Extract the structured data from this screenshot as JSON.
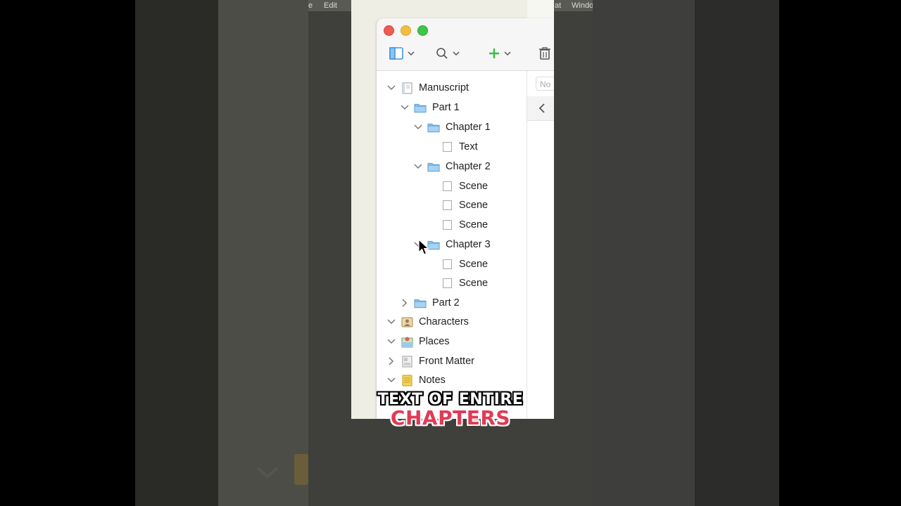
{
  "menubar": {
    "items": [
      "e",
      "Edit",
      "at",
      "Windo"
    ]
  },
  "toolbar": {
    "binder_toggle": "sidebar-toggle-icon",
    "search": "search-icon",
    "add": "add-icon",
    "trash": "trash-icon"
  },
  "editor": {
    "field_placeholder": "No"
  },
  "binder": [
    {
      "label": "Manuscript",
      "icon": "manuscript-icon",
      "disclosure": "expanded"
    },
    {
      "label": "Part 1",
      "icon": "folder-icon",
      "disclosure": "expanded"
    },
    {
      "label": "Chapter 1",
      "icon": "folder-icon",
      "disclosure": "expanded"
    },
    {
      "label": "Text",
      "icon": "document-icon",
      "disclosure": "none"
    },
    {
      "label": "Chapter 2",
      "icon": "folder-icon",
      "disclosure": "expanded"
    },
    {
      "label": "Scene",
      "icon": "document-icon",
      "disclosure": "none"
    },
    {
      "label": "Scene",
      "icon": "document-icon",
      "disclosure": "none"
    },
    {
      "label": "Scene",
      "icon": "document-icon",
      "disclosure": "none"
    },
    {
      "label": "Chapter 3",
      "icon": "folder-icon",
      "disclosure": "expanded"
    },
    {
      "label": "Scene",
      "icon": "document-icon",
      "disclosure": "none"
    },
    {
      "label": "Scene",
      "icon": "document-icon",
      "disclosure": "none"
    },
    {
      "label": "Part 2",
      "icon": "folder-icon",
      "disclosure": "collapsed"
    },
    {
      "label": "Characters",
      "icon": "characters-icon",
      "disclosure": "expanded"
    },
    {
      "label": "Places",
      "icon": "places-icon",
      "disclosure": "expanded"
    },
    {
      "label": "Front Matter",
      "icon": "front-matter-icon",
      "disclosure": "collapsed"
    },
    {
      "label": "Notes",
      "icon": "notes-icon",
      "disclosure": "expanded"
    }
  ],
  "caption": {
    "line1": "TEXT OF ENTIRE",
    "line2": "CHAPTERS"
  },
  "colors": {
    "folder": "#8fc3ea",
    "close": "#ee5b52",
    "minimize": "#f4bd3f",
    "zoom": "#3ec548",
    "add": "#3cba4a",
    "caption_accent": "#e23a55"
  }
}
